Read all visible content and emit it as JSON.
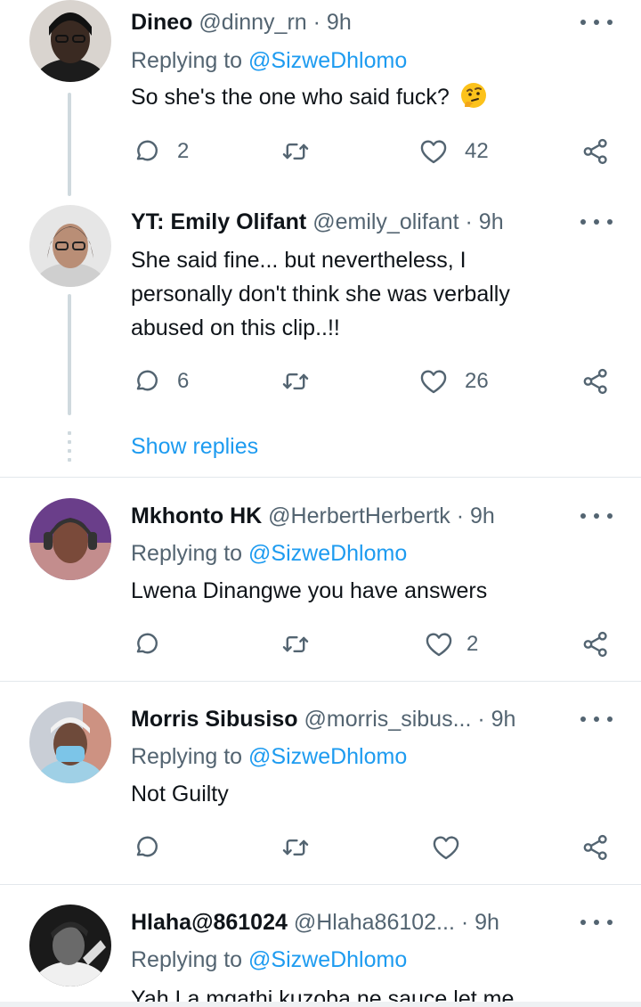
{
  "colors": {
    "accent": "#1d9bf0",
    "muted": "#536471",
    "text": "#0f1419",
    "thread": "#cfd9de"
  },
  "tweets": [
    {
      "name": "Dineo",
      "handle": "@dinny_rn",
      "separator": "·",
      "time": "9h",
      "replying_label": "Replying to",
      "replying_to": "@SizweDhlomo",
      "text": "So she's the one who said fuck?",
      "emoji": "thinking-face",
      "replies": "2",
      "retweets": "",
      "likes": "42"
    },
    {
      "name": "YT: Emily Olifant",
      "handle": "@emily_olifant",
      "separator": "·",
      "time": "9h",
      "text_lines": [
        "She said fine... but nevertheless, I",
        "personally don't think she was verbally",
        "abused on this clip..!!"
      ],
      "replies": "6",
      "retweets": "",
      "likes": "26",
      "show_replies": "Show replies"
    },
    {
      "name": "Mkhonto HK",
      "handle": "@HerbertHerbertk",
      "separator": "·",
      "time": "9h",
      "replying_label": "Replying to",
      "replying_to": "@SizweDhlomo",
      "text": "Lwena Dinangwe you have answers",
      "replies": "",
      "retweets": "",
      "likes": "2"
    },
    {
      "name": "Morris Sibusiso",
      "handle": "@morris_sibus...",
      "separator": "·",
      "time": "9h",
      "replying_label": "Replying to",
      "replying_to": "@SizweDhlomo",
      "text": "Not Guilty",
      "replies": "",
      "retweets": "",
      "likes": ""
    },
    {
      "name": "Hlaha@861024",
      "handle": "@Hlaha86102...",
      "separator": "·",
      "time": "9h",
      "replying_label": "Replying to",
      "replying_to": "@SizweDhlomo",
      "text": "Yah La mgathi kuzoba ne sauce let me"
    }
  ],
  "icons": {
    "reply": "reply-icon",
    "retweet": "retweet-icon",
    "like": "heart-icon",
    "share": "share-icon",
    "more": "more-icon"
  }
}
